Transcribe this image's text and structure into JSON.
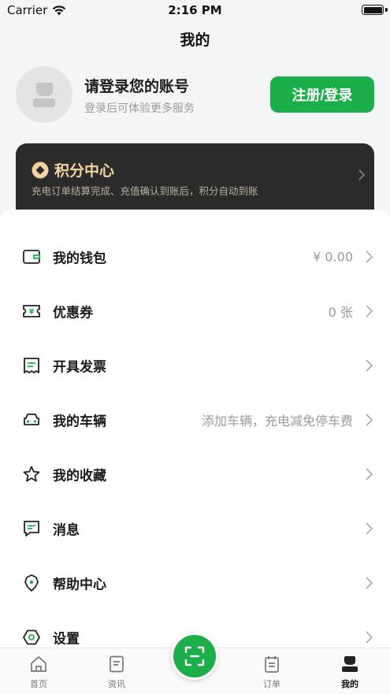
{
  "status_bar": {
    "carrier": "Carrier",
    "time": "2:16 PM"
  },
  "header": {
    "title": "我的"
  },
  "profile": {
    "title": "请登录您的账号",
    "subtitle": "登录后可体验更多服务",
    "login_button": "注册/登录"
  },
  "points": {
    "title": "积分中心",
    "description": "充电订单结算完成、充值确认到账后，积分自动到账"
  },
  "menu": [
    {
      "label": "我的钱包",
      "value": "¥ 0.00",
      "icon": "wallet-icon"
    },
    {
      "label": "优惠券",
      "value": "0 张",
      "icon": "coupon-icon"
    },
    {
      "label": "开具发票",
      "value": "",
      "icon": "invoice-icon"
    },
    {
      "label": "我的车辆",
      "value": "添加车辆，充电减免停车费",
      "icon": "car-icon"
    },
    {
      "label": "我的收藏",
      "value": "",
      "icon": "star-icon"
    },
    {
      "label": "消息",
      "value": "",
      "icon": "message-icon"
    },
    {
      "label": "帮助中心",
      "value": "",
      "icon": "help-icon"
    },
    {
      "label": "设置",
      "value": "",
      "icon": "settings-icon"
    }
  ],
  "tabs": [
    {
      "label": "首页",
      "icon": "home-icon"
    },
    {
      "label": "资讯",
      "icon": "news-icon"
    },
    {
      "label": "订单",
      "icon": "orders-icon"
    },
    {
      "label": "我的",
      "icon": "profile-icon",
      "active": true
    }
  ],
  "colors": {
    "accent": "#1dae4c",
    "points_gold": "#f3d3a1",
    "card_dark": "#2b2b2b"
  }
}
